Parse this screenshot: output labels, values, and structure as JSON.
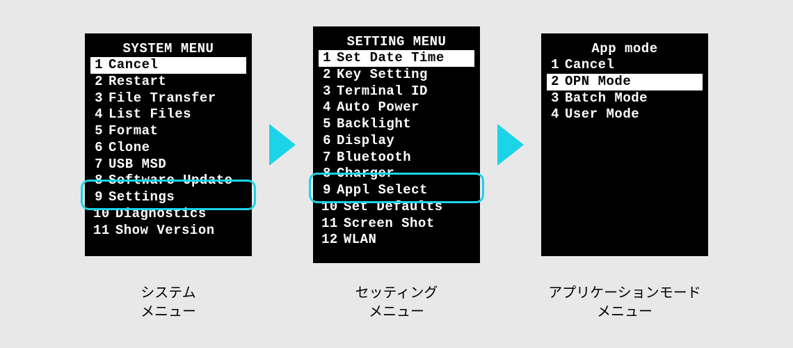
{
  "colors": {
    "highlight": "#1bd4e8",
    "screen_bg": "#000000",
    "screen_fg": "#ffffff",
    "selected_bg": "#ffffff",
    "selected_fg": "#000000",
    "page_bg": "#e8e8e8"
  },
  "screens": [
    {
      "id": "system-menu",
      "title": "SYSTEM MENU",
      "selected_index": 0,
      "highlight_index": 8,
      "items": [
        {
          "num": "1",
          "label": "Cancel"
        },
        {
          "num": "2",
          "label": "Restart"
        },
        {
          "num": "3",
          "label": "File Transfer"
        },
        {
          "num": "4",
          "label": "List Files"
        },
        {
          "num": "5",
          "label": "Format"
        },
        {
          "num": "6",
          "label": "Clone"
        },
        {
          "num": "7",
          "label": "USB MSD"
        },
        {
          "num": "8",
          "label": "Software Update"
        },
        {
          "num": "9",
          "label": "Settings"
        },
        {
          "num": "10",
          "label": "Diagnostics"
        },
        {
          "num": "11",
          "label": "Show Version"
        }
      ],
      "caption": "システム\nメニュー"
    },
    {
      "id": "setting-menu",
      "title": "SETTING MENU",
      "selected_index": 0,
      "highlight_index": 8,
      "items": [
        {
          "num": "1",
          "label": "Set Date Time"
        },
        {
          "num": "2",
          "label": "Key Setting"
        },
        {
          "num": "3",
          "label": "Terminal ID"
        },
        {
          "num": "4",
          "label": "Auto Power"
        },
        {
          "num": "5",
          "label": "Backlight"
        },
        {
          "num": "6",
          "label": "Display"
        },
        {
          "num": "7",
          "label": "Bluetooth"
        },
        {
          "num": "8",
          "label": "Charger"
        },
        {
          "num": "9",
          "label": "Appl Select"
        },
        {
          "num": "10",
          "label": "Set Defaults"
        },
        {
          "num": "11",
          "label": "Screen Shot"
        },
        {
          "num": "12",
          "label": "WLAN"
        }
      ],
      "caption": "セッティング\nメニュー"
    },
    {
      "id": "app-mode-menu",
      "title": "App mode",
      "selected_index": 1,
      "highlight_index": null,
      "items": [
        {
          "num": "1",
          "label": "Cancel"
        },
        {
          "num": "2",
          "label": "OPN Mode"
        },
        {
          "num": "3",
          "label": "Batch Mode"
        },
        {
          "num": "4",
          "label": "User Mode"
        }
      ],
      "caption": "アプリケーションモード\nメニュー"
    }
  ]
}
